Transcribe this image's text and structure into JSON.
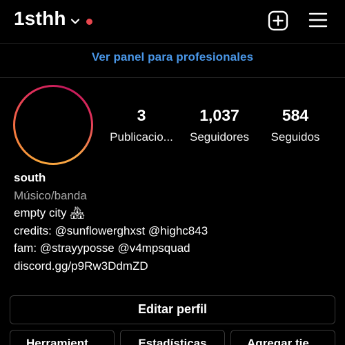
{
  "header": {
    "username": "1sthh",
    "notification_dot_color": "#e8474e",
    "icons": [
      "chevron-down-icon",
      "plus-square-icon",
      "hamburger-menu-icon"
    ]
  },
  "professional_dashboard": {
    "label": "Ver panel para profesionales",
    "color": "#4a97e8"
  },
  "profile": {
    "stats": [
      {
        "value": "3",
        "label": "Publicacio..."
      },
      {
        "value": "1,037",
        "label": "Seguidores"
      },
      {
        "value": "584",
        "label": "Seguidos"
      }
    ],
    "bio": {
      "name": "south",
      "category": "Músico/banda",
      "lines": [
        "empty city 🏘",
        "credits: @sunflowerghxst @highc843",
        "fam: @strayyposse @v4mpsquad",
        "discord.gg/p9Rw3DdmZD"
      ]
    }
  },
  "buttons": {
    "edit_profile": "Editar perfil",
    "tools": "Herramient...",
    "insights": "Estadísticas",
    "add_shop": "Agregar tie..."
  }
}
